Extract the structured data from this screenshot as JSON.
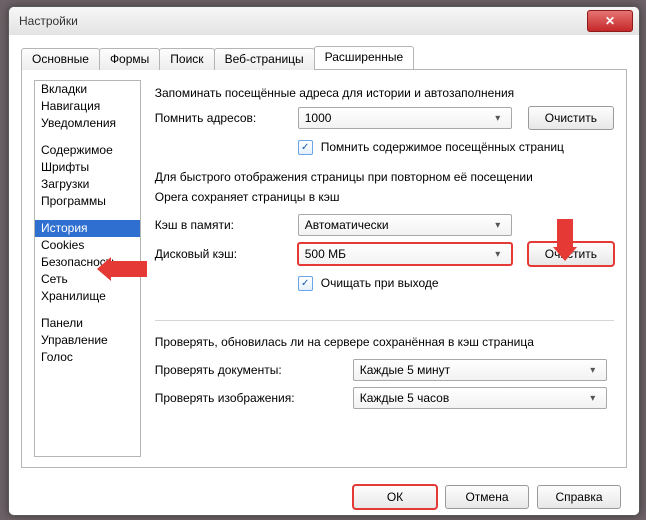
{
  "window": {
    "title": "Настройки",
    "close_glyph": "✕"
  },
  "tabs": [
    {
      "label": "Основные"
    },
    {
      "label": "Формы"
    },
    {
      "label": "Поиск"
    },
    {
      "label": "Веб-страницы"
    },
    {
      "label": "Расширенные",
      "active": true
    }
  ],
  "categories": {
    "groups": [
      [
        "Вкладки",
        "Навигация",
        "Уведомления"
      ],
      [
        "Содержимое",
        "Шрифты",
        "Загрузки",
        "Программы"
      ],
      [
        "История",
        "Cookies",
        "Безопасность",
        "Сеть",
        "Хранилище"
      ],
      [
        "Панели",
        "Управление",
        "Голос"
      ]
    ],
    "selected": "История"
  },
  "content": {
    "caption1": "Запоминать посещённые адреса для истории и автозаполнения",
    "remember_addresses": {
      "label": "Помнить адресов:",
      "value": "1000",
      "clear": "Очистить"
    },
    "remember_content": {
      "checked": true,
      "label": "Помнить содержимое посещённых страниц"
    },
    "caption2a": "Для быстрого отображения страницы при повторном её посещении",
    "caption2b": "Opera сохраняет страницы в кэш",
    "mem_cache": {
      "label": "Кэш в памяти:",
      "value": "Автоматически"
    },
    "disk_cache": {
      "label": "Дисковый кэш:",
      "value": "500 МБ",
      "clear": "Очистить"
    },
    "clear_on_exit": {
      "checked": true,
      "label": "Очищать при выходе"
    },
    "caption3": "Проверять, обновилась ли на сервере сохранённая в кэш страница",
    "check_docs": {
      "label": "Проверять документы:",
      "value": "Каждые 5 минут"
    },
    "check_images": {
      "label": "Проверять изображения:",
      "value": "Каждые 5 часов"
    }
  },
  "footer": {
    "ok": "ОК",
    "cancel": "Отмена",
    "help": "Справка"
  }
}
